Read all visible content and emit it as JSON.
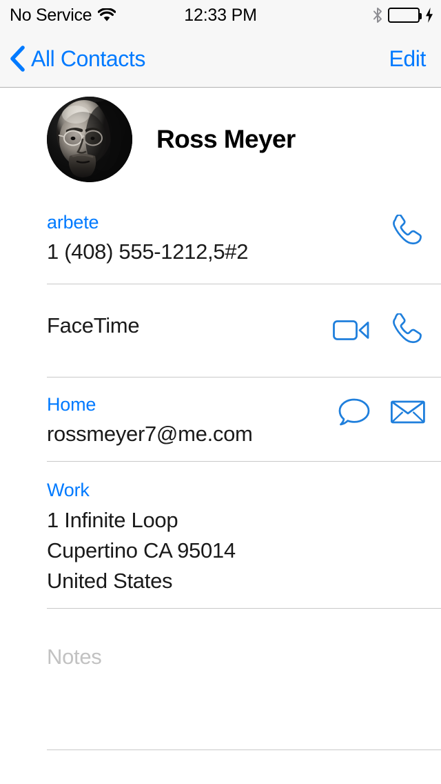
{
  "statusbar": {
    "carrier": "No Service",
    "time": "12:33 PM",
    "wifi_icon": "wifi-icon",
    "bluetooth_icon": "bluetooth-icon",
    "battery_icon": "battery-full-icon",
    "charging_icon": "lightning-bolt-icon",
    "battery_color": "#4cd552"
  },
  "navbar": {
    "back_label": "All Contacts",
    "back_icon": "chevron-left-icon",
    "edit_label": "Edit",
    "accent_color": "#007aff"
  },
  "contact": {
    "name": "Ross Meyer",
    "avatar_icon": "contact-photo-avatar"
  },
  "rows": {
    "phone": {
      "label": "arbete",
      "value": "1 (408) 555-1212,5#2",
      "call_icon": "phone-handset-icon"
    },
    "facetime": {
      "label": "FaceTime",
      "video_icon": "video-camera-icon",
      "audio_icon": "phone-handset-icon"
    },
    "email": {
      "label": "Home",
      "value": "rossmeyer7@me.com",
      "message_icon": "message-bubble-icon",
      "mail_icon": "envelope-icon"
    },
    "address": {
      "label": "Work",
      "lines": [
        "1 Infinite Loop",
        "Cupertino CA 95014",
        "United States"
      ]
    },
    "notes": {
      "placeholder": "Notes"
    }
  }
}
